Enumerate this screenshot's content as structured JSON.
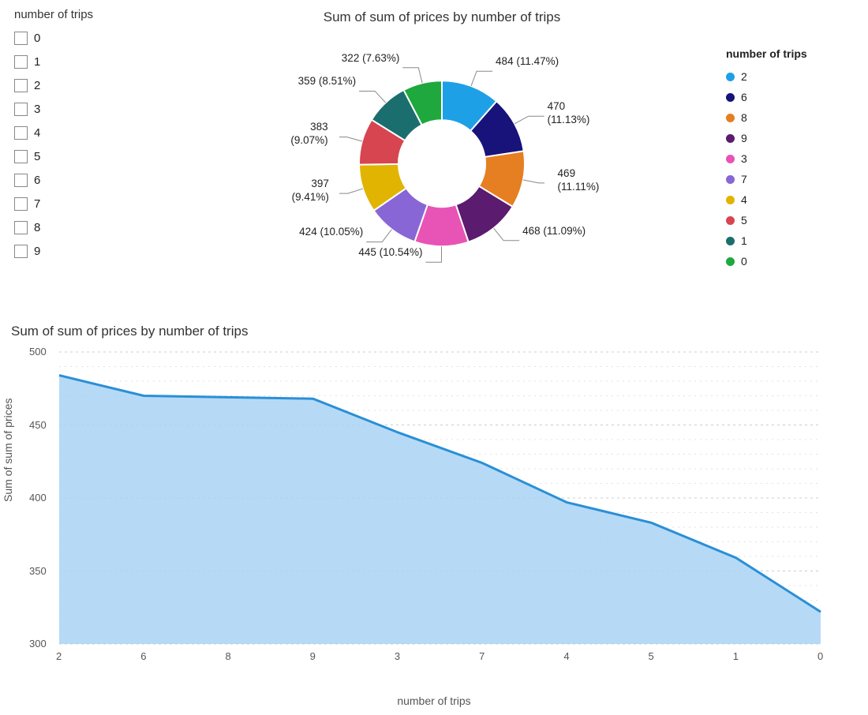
{
  "slicer": {
    "title": "number of trips",
    "options": [
      "0",
      "1",
      "2",
      "3",
      "4",
      "5",
      "6",
      "7",
      "8",
      "9"
    ]
  },
  "donut": {
    "title": "Sum of sum of prices by number of trips",
    "legend_title": "number of trips"
  },
  "area": {
    "title": "Sum of sum of prices by number of trips",
    "ylabel": "Sum of sum of prices",
    "xlabel": "number of trips",
    "y_ticks": [
      "500",
      "450",
      "400",
      "350",
      "300"
    ]
  },
  "chart_data": [
    {
      "type": "pie",
      "title": "Sum of sum of prices by number of trips",
      "slices": [
        {
          "category": "2",
          "value": 484,
          "pct": 11.47,
          "color": "#1ea0e6"
        },
        {
          "category": "6",
          "value": 470,
          "pct": 11.13,
          "color": "#17137a"
        },
        {
          "category": "8",
          "value": 469,
          "pct": 11.11,
          "color": "#e67e22"
        },
        {
          "category": "9",
          "value": 468,
          "pct": 11.09,
          "color": "#5b1b6e"
        },
        {
          "category": "3",
          "value": 445,
          "pct": 10.54,
          "color": "#e754b5"
        },
        {
          "category": "7",
          "value": 424,
          "pct": 10.05,
          "color": "#8866d6"
        },
        {
          "category": "4",
          "value": 397,
          "pct": 9.41,
          "color": "#e0b400"
        },
        {
          "category": "5",
          "value": 383,
          "pct": 9.07,
          "color": "#d64550"
        },
        {
          "category": "1",
          "value": 359,
          "pct": 8.51,
          "color": "#1b6e6e"
        },
        {
          "category": "0",
          "value": 322,
          "pct": 7.63,
          "color": "#1fa83d"
        }
      ]
    },
    {
      "type": "area",
      "title": "Sum of sum of prices by number of trips",
      "xlabel": "number of trips",
      "ylabel": "Sum of sum of prices",
      "ylim": [
        300,
        500
      ],
      "categories": [
        "2",
        "6",
        "8",
        "9",
        "3",
        "7",
        "4",
        "5",
        "1",
        "0"
      ],
      "values": [
        484,
        470,
        469,
        468,
        445,
        424,
        397,
        383,
        359,
        322
      ],
      "color": "#2a8fd6",
      "fill": "#a9d3f4"
    }
  ]
}
